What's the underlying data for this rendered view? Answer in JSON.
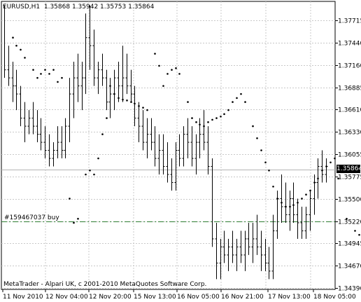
{
  "header": {
    "symbol_timeframe": "EURUSD,H1",
    "open": "1.35868",
    "high": "1.35942",
    "low": "1.35753",
    "close": "1.35864"
  },
  "current_price_label": "1.35864",
  "order_line_label": "#159467037 buy",
  "copyright": "MetaTrader - Alpari UK, c 2001-2010 MetaQuotes Software Corp.",
  "price_axis": {
    "ticks": [
      "1.37715",
      "1.37440",
      "1.37160",
      "1.36885",
      "1.36610",
      "1.36330",
      "1.36055",
      "1.35775",
      "1.35500",
      "1.35220",
      "1.34945",
      "1.34670",
      "1.34390"
    ]
  },
  "time_axis": {
    "ticks": [
      "11 Nov 2010",
      "12 Nov 04:00",
      "12 Nov 20:00",
      "15 Nov 13:00",
      "16 Nov 05:00",
      "16 Nov 21:00",
      "17 Nov 13:00",
      "18 Nov 05:00"
    ]
  },
  "colors": {
    "background": "#ffffff",
    "bars": "#000000",
    "grid": "#c8c8c8",
    "order_line": "#2e7d32",
    "bid_line": "#b4b4b4"
  },
  "chart_data": {
    "type": "ohlc",
    "title": "EURUSD,H1",
    "ylim": [
      1.3439,
      1.37715
    ],
    "grid": true,
    "current_price": 1.35864,
    "order_price": 1.3522,
    "ohlc": [
      [
        1.379,
        1.379,
        1.37,
        1.371
      ],
      [
        1.371,
        1.374,
        1.369,
        1.37
      ],
      [
        1.37,
        1.372,
        1.367,
        1.369
      ],
      [
        1.369,
        1.371,
        1.366,
        1.368
      ],
      [
        1.368,
        1.369,
        1.364,
        1.365
      ],
      [
        1.365,
        1.367,
        1.362,
        1.364
      ],
      [
        1.364,
        1.366,
        1.363,
        1.365
      ],
      [
        1.365,
        1.367,
        1.363,
        1.364
      ],
      [
        1.364,
        1.366,
        1.362,
        1.363
      ],
      [
        1.363,
        1.365,
        1.361,
        1.362
      ],
      [
        1.362,
        1.364,
        1.36,
        1.361
      ],
      [
        1.361,
        1.363,
        1.359,
        1.36
      ],
      [
        1.36,
        1.362,
        1.359,
        1.361
      ],
      [
        1.361,
        1.364,
        1.36,
        1.362
      ],
      [
        1.362,
        1.364,
        1.36,
        1.361
      ],
      [
        1.361,
        1.365,
        1.36,
        1.364
      ],
      [
        1.364,
        1.37,
        1.362,
        1.368
      ],
      [
        1.368,
        1.372,
        1.365,
        1.37
      ],
      [
        1.37,
        1.373,
        1.367,
        1.369
      ],
      [
        1.369,
        1.372,
        1.366,
        1.37
      ],
      [
        1.37,
        1.378,
        1.368,
        1.375
      ],
      [
        1.375,
        1.379,
        1.371,
        1.374
      ],
      [
        1.374,
        1.376,
        1.369,
        1.37
      ],
      [
        1.37,
        1.372,
        1.368,
        1.371
      ],
      [
        1.371,
        1.373,
        1.369,
        1.37
      ],
      [
        1.37,
        1.371,
        1.366,
        1.367
      ],
      [
        1.367,
        1.37,
        1.365,
        1.368
      ],
      [
        1.368,
        1.371,
        1.366,
        1.37
      ],
      [
        1.37,
        1.372,
        1.367,
        1.369
      ],
      [
        1.369,
        1.374,
        1.367,
        1.37
      ],
      [
        1.37,
        1.373,
        1.368,
        1.369
      ],
      [
        1.369,
        1.371,
        1.367,
        1.368
      ],
      [
        1.368,
        1.369,
        1.364,
        1.365
      ],
      [
        1.365,
        1.367,
        1.362,
        1.364
      ],
      [
        1.364,
        1.366,
        1.361,
        1.362
      ],
      [
        1.362,
        1.365,
        1.36,
        1.363
      ],
      [
        1.363,
        1.365,
        1.361,
        1.362
      ],
      [
        1.362,
        1.364,
        1.359,
        1.36
      ],
      [
        1.36,
        1.363,
        1.358,
        1.361
      ],
      [
        1.361,
        1.363,
        1.358,
        1.359
      ],
      [
        1.359,
        1.362,
        1.357,
        1.358
      ],
      [
        1.358,
        1.36,
        1.356,
        1.357
      ],
      [
        1.357,
        1.362,
        1.356,
        1.361
      ],
      [
        1.361,
        1.363,
        1.359,
        1.36
      ],
      [
        1.36,
        1.364,
        1.359,
        1.363
      ],
      [
        1.363,
        1.365,
        1.36,
        1.362
      ],
      [
        1.362,
        1.364,
        1.359,
        1.36
      ],
      [
        1.36,
        1.363,
        1.358,
        1.362
      ],
      [
        1.362,
        1.365,
        1.36,
        1.363
      ],
      [
        1.363,
        1.366,
        1.361,
        1.362
      ],
      [
        1.362,
        1.364,
        1.358,
        1.359
      ],
      [
        1.359,
        1.36,
        1.349,
        1.35
      ],
      [
        1.35,
        1.352,
        1.345,
        1.347
      ],
      [
        1.347,
        1.35,
        1.345,
        1.349
      ],
      [
        1.349,
        1.351,
        1.347,
        1.348
      ],
      [
        1.348,
        1.35,
        1.346,
        1.349
      ],
      [
        1.349,
        1.351,
        1.347,
        1.348
      ],
      [
        1.348,
        1.35,
        1.346,
        1.349
      ],
      [
        1.349,
        1.351,
        1.347,
        1.348
      ],
      [
        1.348,
        1.351,
        1.346,
        1.35
      ],
      [
        1.35,
        1.352,
        1.348,
        1.349
      ],
      [
        1.349,
        1.352,
        1.347,
        1.35
      ],
      [
        1.35,
        1.353,
        1.348,
        1.349
      ],
      [
        1.349,
        1.351,
        1.346,
        1.348
      ],
      [
        1.348,
        1.35,
        1.346,
        1.347
      ],
      [
        1.347,
        1.349,
        1.345,
        1.346
      ],
      [
        1.346,
        1.353,
        1.345,
        1.351
      ],
      [
        1.351,
        1.356,
        1.35,
        1.355
      ],
      [
        1.355,
        1.358,
        1.352,
        1.354
      ],
      [
        1.354,
        1.357,
        1.352,
        1.353
      ],
      [
        1.353,
        1.356,
        1.351,
        1.355
      ],
      [
        1.355,
        1.357,
        1.352,
        1.353
      ],
      [
        1.353,
        1.355,
        1.35,
        1.352
      ],
      [
        1.352,
        1.354,
        1.35,
        1.351
      ],
      [
        1.351,
        1.354,
        1.35,
        1.353
      ],
      [
        1.353,
        1.356,
        1.351,
        1.355
      ],
      [
        1.355,
        1.358,
        1.353,
        1.357
      ],
      [
        1.357,
        1.36,
        1.355,
        1.359
      ],
      [
        1.359,
        1.361,
        1.357,
        1.358
      ],
      [
        1.358,
        1.36,
        1.357,
        1.359
      ]
    ],
    "psar": [
      {
        "i": 2,
        "y": 1.375
      },
      {
        "i": 3,
        "y": 1.374
      },
      {
        "i": 4,
        "y": 1.3735
      },
      {
        "i": 5,
        "y": 1.3725
      },
      {
        "i": 7,
        "y": 1.371
      },
      {
        "i": 8,
        "y": 1.37
      },
      {
        "i": 9,
        "y": 1.3705
      },
      {
        "i": 10,
        "y": 1.371
      },
      {
        "i": 11,
        "y": 1.3705
      },
      {
        "i": 12,
        "y": 1.371
      },
      {
        "i": 13,
        "y": 1.3695
      },
      {
        "i": 14,
        "y": 1.37
      },
      {
        "i": 16,
        "y": 1.355
      },
      {
        "i": 17,
        "y": 1.352
      },
      {
        "i": 18,
        "y": 1.3525
      },
      {
        "i": 20,
        "y": 1.358
      },
      {
        "i": 21,
        "y": 1.3585
      },
      {
        "i": 22,
        "y": 1.358
      },
      {
        "i": 23,
        "y": 1.36
      },
      {
        "i": 24,
        "y": 1.363
      },
      {
        "i": 25,
        "y": 1.365
      },
      {
        "i": 26,
        "y": 1.369
      },
      {
        "i": 27,
        "y": 1.368
      },
      {
        "i": 28,
        "y": 1.3675
      },
      {
        "i": 29,
        "y": 1.3673
      },
      {
        "i": 30,
        "y": 1.3672
      },
      {
        "i": 31,
        "y": 1.367
      },
      {
        "i": 32,
        "y": 1.3668
      },
      {
        "i": 33,
        "y": 1.3665
      },
      {
        "i": 34,
        "y": 1.3663
      },
      {
        "i": 35,
        "y": 1.366
      },
      {
        "i": 37,
        "y": 1.373
      },
      {
        "i": 38,
        "y": 1.3715
      },
      {
        "i": 39,
        "y": 1.369
      },
      {
        "i": 40,
        "y": 1.3705
      },
      {
        "i": 41,
        "y": 1.371
      },
      {
        "i": 42,
        "y": 1.3712
      },
      {
        "i": 43,
        "y": 1.3705
      },
      {
        "i": 45,
        "y": 1.367
      },
      {
        "i": 46,
        "y": 1.365
      },
      {
        "i": 47,
        "y": 1.3645
      },
      {
        "i": 48,
        "y": 1.3642
      },
      {
        "i": 49,
        "y": 1.364
      },
      {
        "i": 50,
        "y": 1.3645
      },
      {
        "i": 51,
        "y": 1.3648
      },
      {
        "i": 52,
        "y": 1.365
      },
      {
        "i": 53,
        "y": 1.3652
      },
      {
        "i": 54,
        "y": 1.3655
      },
      {
        "i": 55,
        "y": 1.366
      },
      {
        "i": 56,
        "y": 1.367
      },
      {
        "i": 57,
        "y": 1.3675
      },
      {
        "i": 58,
        "y": 1.368
      },
      {
        "i": 59,
        "y": 1.367
      },
      {
        "i": 61,
        "y": 1.364
      },
      {
        "i": 62,
        "y": 1.3625
      },
      {
        "i": 63,
        "y": 1.361
      },
      {
        "i": 64,
        "y": 1.3595
      },
      {
        "i": 65,
        "y": 1.3585
      },
      {
        "i": 66,
        "y": 1.3565
      },
      {
        "i": 67,
        "y": 1.355
      },
      {
        "i": 68,
        "y": 1.3545
      },
      {
        "i": 69,
        "y": 1.354
      },
      {
        "i": 70,
        "y": 1.354
      },
      {
        "i": 71,
        "y": 1.3542
      },
      {
        "i": 72,
        "y": 1.3545
      },
      {
        "i": 73,
        "y": 1.355
      },
      {
        "i": 74,
        "y": 1.3555
      },
      {
        "i": 75,
        "y": 1.356
      },
      {
        "i": 76,
        "y": 1.357
      },
      {
        "i": 77,
        "y": 1.3575
      },
      {
        "i": 78,
        "y": 1.3585
      },
      {
        "i": 79,
        "y": 1.359
      },
      {
        "i": 80,
        "y": 1.3595
      },
      {
        "i": 81,
        "y": 1.36
      },
      {
        "i": 82,
        "y": 1.3575
      },
      {
        "i": 84,
        "y": 1.3525
      },
      {
        "i": 86,
        "y": 1.351
      },
      {
        "i": 87,
        "y": 1.3505
      },
      {
        "i": 88,
        "y": 1.349
      },
      {
        "i": 89,
        "y": 1.352
      },
      {
        "i": 90,
        "y": 1.3523
      },
      {
        "i": 91,
        "y": 1.3525
      },
      {
        "i": 92,
        "y": 1.3526
      },
      {
        "i": 93,
        "y": 1.3527
      }
    ]
  }
}
